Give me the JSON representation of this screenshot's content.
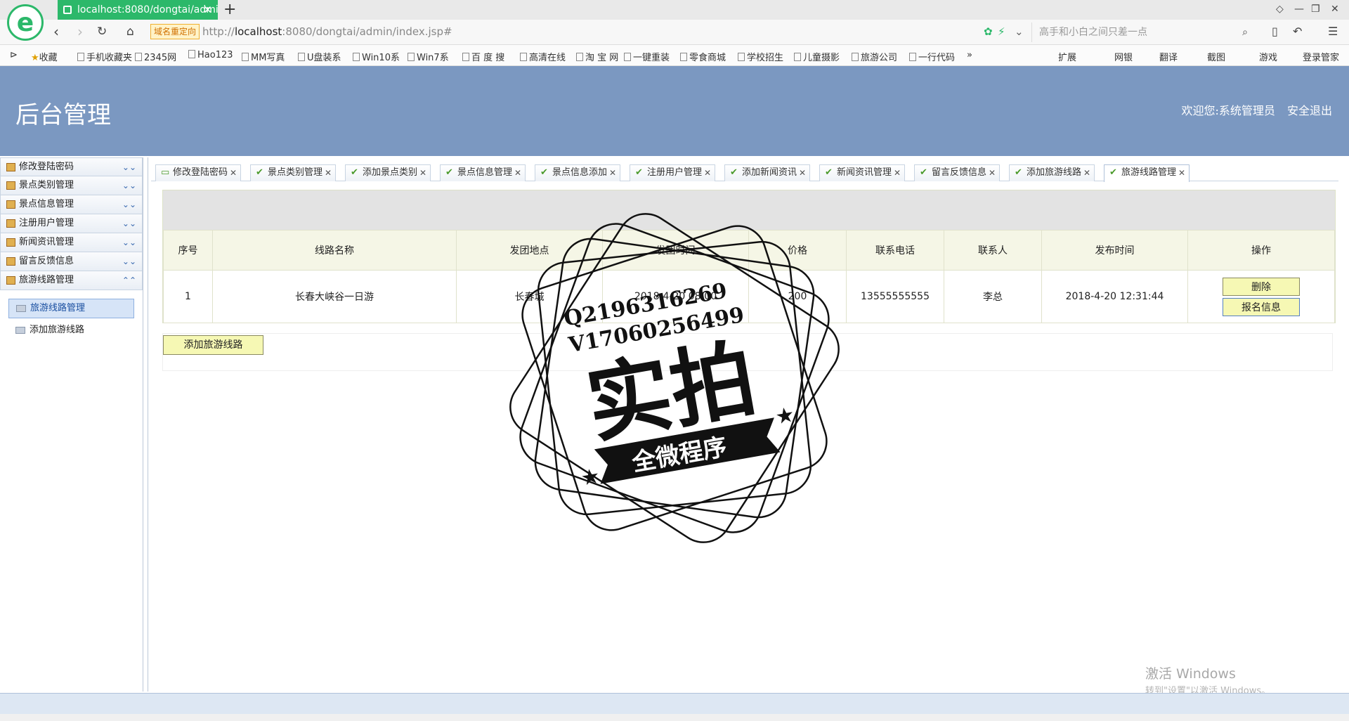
{
  "browser": {
    "tab_title": "localhost:8080/dongtai/admi",
    "tab_close": "✕",
    "new_tab": "+",
    "redirect_badge": "域名重定向",
    "url_prefix": "http://",
    "url_host": "localhost",
    "url_rest": ":8080/dongtai/admin/index.jsp#",
    "search_placeholder": "高手和小白之间只差一点",
    "bookmarks": [
      "收藏",
      "手机收藏夹",
      "2345网",
      "Hao123",
      "MM写真",
      "U盘装系",
      "Win10系",
      "Win7系",
      "百 度 搜",
      "高清在线",
      "淘 宝 网",
      "一键重装",
      "零食商城",
      "学校招生",
      "儿童摄影",
      "旅游公司",
      "一行代码",
      "»"
    ],
    "right_tools": [
      "扩展",
      "网银",
      "翻译",
      "截图",
      "游戏",
      "登录管家"
    ]
  },
  "header": {
    "title": "后台管理",
    "welcome": "欢迎您:系统管理员",
    "logout": "安全退出"
  },
  "sidebar": {
    "menus": [
      "修改登陆密码",
      "景点类别管理",
      "景点信息管理",
      "注册用户管理",
      "新闻资讯管理",
      "留言反馈信息",
      "旅游线路管理"
    ],
    "sub_items": [
      "旅游线路管理",
      "添加旅游线路"
    ]
  },
  "tabs": [
    "修改登陆密码",
    "景点类别管理",
    "添加景点类别",
    "景点信息管理",
    "景点信息添加",
    "注册用户管理",
    "添加新闻资讯",
    "新闻资讯管理",
    "留言反馈信息",
    "添加旅游线路",
    "旅游线路管理"
  ],
  "table": {
    "headers": [
      "序号",
      "线路名称",
      "发团地点",
      "发团时间",
      "价格",
      "联系电话",
      "联系人",
      "发布时间",
      "操作"
    ],
    "rows": [
      {
        "no": "1",
        "name": "长春大峡谷一日游",
        "place": "长春城",
        "time": "2018-4-20 08:00",
        "price": "200",
        "phone": "13555555555",
        "contact": "李总",
        "published": "2018-4-20 12:31:44",
        "delete_label": "删除",
        "signup_label": "报名信息"
      }
    ]
  },
  "add_button": "添加旅游线路",
  "watermark": {
    "line1": "Q2196316269",
    "line2": "V17060256499",
    "big": "实拍",
    "ribbon": "全微程序"
  },
  "windows_activation": {
    "title": "激活 Windows",
    "subtitle": "转到\"设置\"以激活 Windows。"
  }
}
